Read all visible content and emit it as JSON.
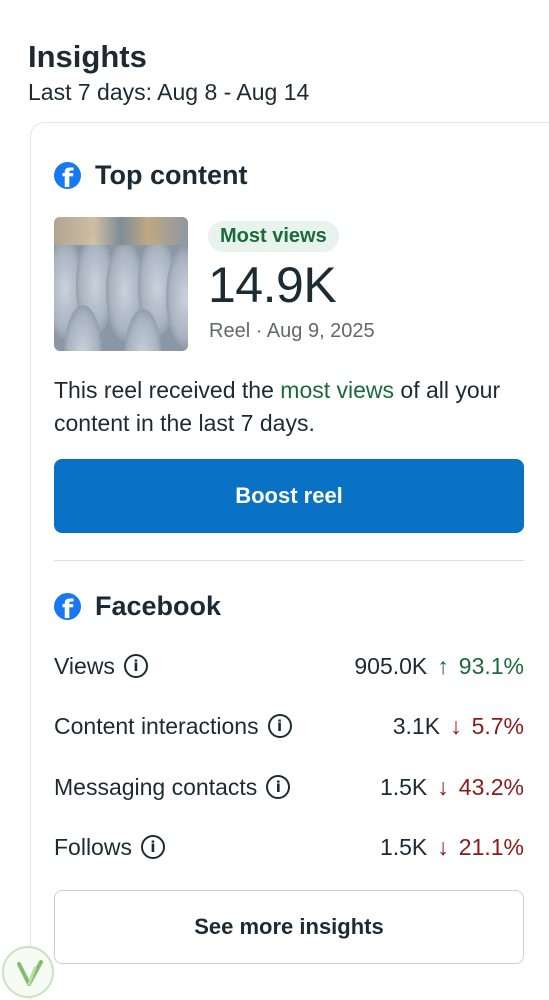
{
  "header": {
    "title": "Insights",
    "subtitle": "Last 7 days: Aug 8 - Aug 14"
  },
  "top_content": {
    "section_title": "Top content",
    "badge": "Most views",
    "value": "14.9K",
    "meta": "Reel · Aug 9, 2025",
    "desc_before": "This reel received the ",
    "desc_highlight": "most views",
    "desc_after": " of all your content in the last 7 days.",
    "boost_label": "Boost reel"
  },
  "facebook": {
    "section_title": "Facebook",
    "metrics": [
      {
        "label": "Views",
        "value": "905.0K",
        "arrow": "↑",
        "change": "93.1%",
        "trend": "up"
      },
      {
        "label": "Content interactions",
        "value": "3.1K",
        "arrow": "↓",
        "change": "5.7%",
        "trend": "down"
      },
      {
        "label": "Messaging contacts",
        "value": "1.5K",
        "arrow": "↓",
        "change": "43.2%",
        "trend": "down"
      },
      {
        "label": "Follows",
        "value": "1.5K",
        "arrow": "↓",
        "change": "21.1%",
        "trend": "down"
      }
    ],
    "see_more_label": "See more insights"
  },
  "icons": {
    "facebook": "facebook-logo-icon",
    "info": "info-icon",
    "arrow_up": "arrow-up-icon",
    "arrow_down": "arrow-down-icon"
  },
  "colors": {
    "facebook_blue": "#1877f2",
    "boost_button": "#0a72c5",
    "positive": "#1b6b3a",
    "negative": "#8b1a1a",
    "badge_bg": "#e7f3ec"
  }
}
